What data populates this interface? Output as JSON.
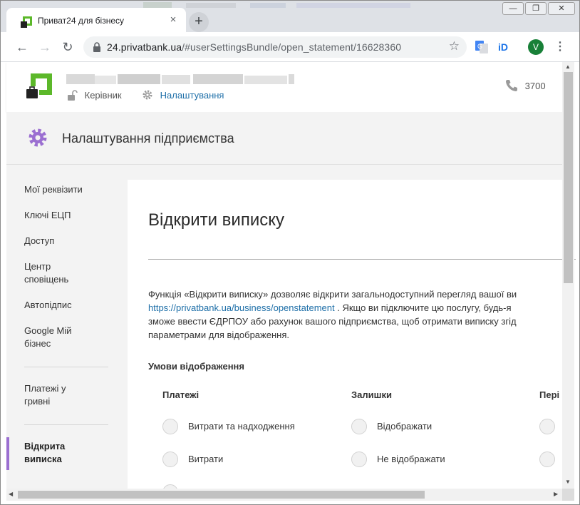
{
  "browser": {
    "tab_title": "Приват24 для бізнесу",
    "tab_close": "×",
    "new_tab": "+",
    "url_host": "24.privatbank.ua",
    "url_path": "/#userSettingsBundle/open_statement/16628360",
    "profile_initial": "V",
    "window_controls": [
      "—",
      "❐",
      "✕"
    ],
    "nav": {
      "back": "←",
      "forward": "→",
      "reload": "↻",
      "star": "☆",
      "menu": "⋮"
    }
  },
  "header": {
    "role_label": "Керівник",
    "settings_label": "Налаштування",
    "phone_number": "3700"
  },
  "section": {
    "title": "Налаштування підприємства"
  },
  "sidebar": {
    "items": [
      {
        "label": "Мої реквізити"
      },
      {
        "label": "Ключі ЕЦП"
      },
      {
        "label": "Доступ"
      },
      {
        "label": "Центр сповіщень"
      },
      {
        "label": "Автопідпис"
      },
      {
        "label": "Google Мій бізнес"
      },
      {
        "label": "Платежі у гривні"
      },
      {
        "label": "Відкрита виписка"
      }
    ],
    "active_index": 7
  },
  "content": {
    "title": "Відкрити виписку",
    "desc_line1": "Функція «Відкрити виписку» дозволяє відкрити загальнодоступний перегляд вашої ви",
    "desc_link": "https://privatbank.ua/business/openstatement",
    "desc_line2_rest": " . Якщо ви підключите цю послугу, будь-я",
    "desc_line3": "зможе ввести ЄДРПОУ або рахунок вашого підприємства, щоб отримати виписку згід",
    "desc_line4": "параметрами для відображення.",
    "conditions_title": "Умови відображення",
    "columns": [
      {
        "header": "Платежі",
        "options": [
          "Витрати та надходження",
          "Витрати"
        ]
      },
      {
        "header": "Залишки",
        "options": [
          "Відображати",
          "Не відображати"
        ]
      },
      {
        "header": "Пері",
        "options": [
          "",
          ""
        ]
      }
    ]
  },
  "colors": {
    "brand_green": "#5cb82a",
    "accent_purple": "#9b6fd1",
    "link_blue": "#1e6fa8"
  }
}
